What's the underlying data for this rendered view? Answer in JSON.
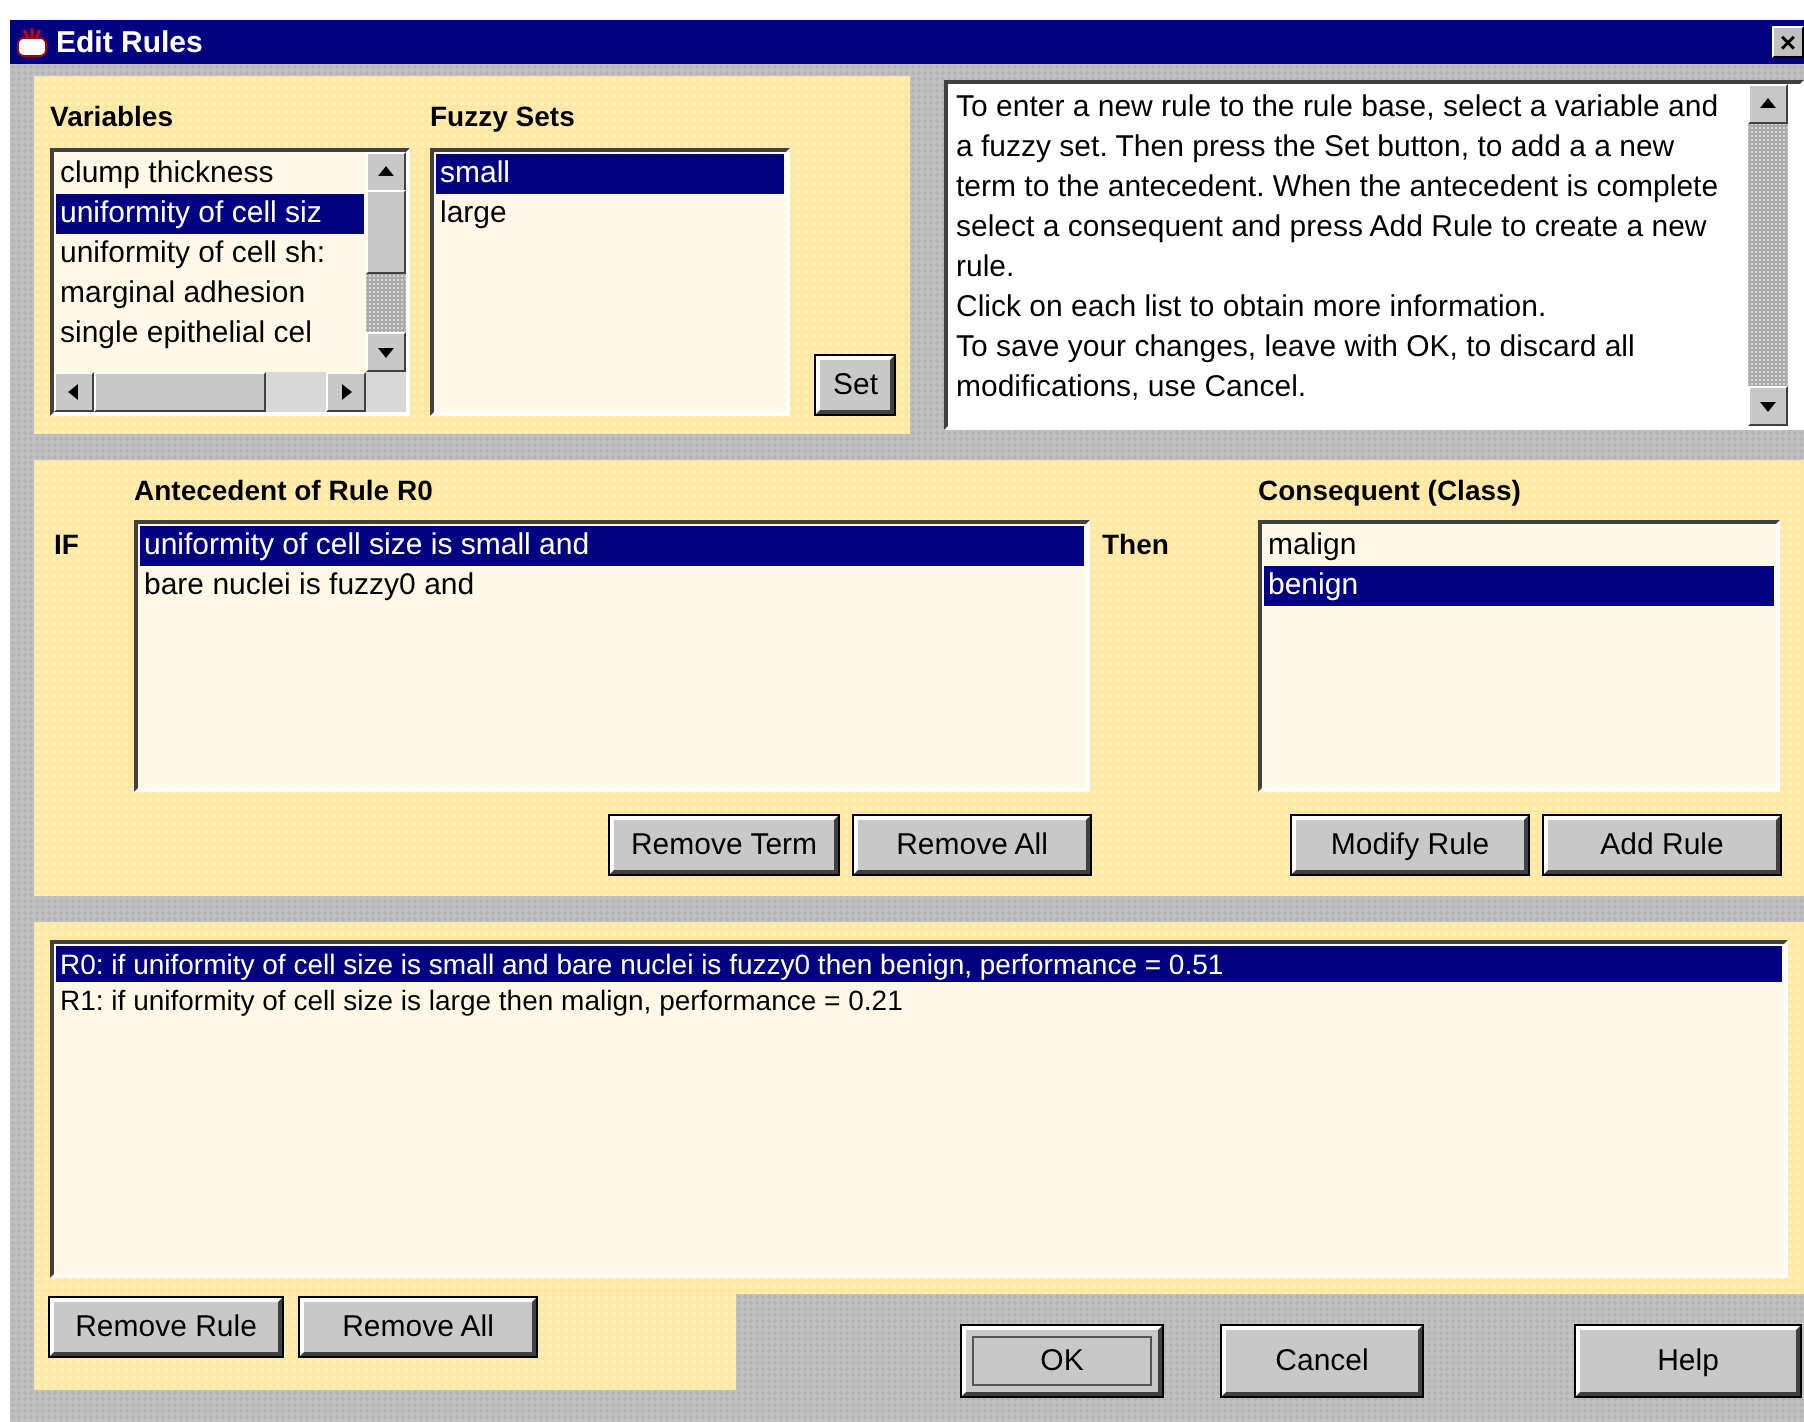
{
  "window": {
    "title": "Edit Rules",
    "close": "×"
  },
  "variables": {
    "label": "Variables",
    "items": [
      {
        "text": "clump thickness",
        "selected": false
      },
      {
        "text": "uniformity of cell siz",
        "selected": true
      },
      {
        "text": "uniformity of cell sh:",
        "selected": false
      },
      {
        "text": "marginal adhesion",
        "selected": false
      },
      {
        "text": "single epithelial cel",
        "selected": false
      }
    ]
  },
  "fuzzy_sets": {
    "label": "Fuzzy Sets",
    "items": [
      {
        "text": "small",
        "selected": true
      },
      {
        "text": "large",
        "selected": false
      }
    ]
  },
  "set_button": "Set",
  "info_text": [
    "To enter a new rule to the rule base, select a variable and a fuzzy set. Then press the Set button, to add a a new term to the antecedent. When the antecedent is complete select a consequent and press Add Rule to create a new rule.",
    "Click on each list to obtain more information.",
    "To save your changes, leave with OK, to discard all modifications, use Cancel."
  ],
  "antecedent": {
    "label": "Antecedent of Rule R0",
    "if_label": "IF",
    "items": [
      {
        "text": "uniformity of cell size is small and",
        "selected": true
      },
      {
        "text": "bare nuclei is fuzzy0 and",
        "selected": false
      }
    ],
    "buttons": [
      "Remove Term",
      "Remove All"
    ]
  },
  "consequent": {
    "then_label": "Then",
    "label": "Consequent (Class)",
    "items": [
      {
        "text": "malign",
        "selected": false
      },
      {
        "text": "benign",
        "selected": true
      }
    ],
    "buttons": [
      "Modify Rule",
      "Add Rule"
    ]
  },
  "rules": {
    "items": [
      {
        "text": "R0: if uniformity of cell size is small and bare nuclei is fuzzy0 then benign, performance = 0.51",
        "selected": true
      },
      {
        "text": "R1: if uniformity of cell size is large then malign, performance = 0.21",
        "selected": false
      }
    ],
    "buttons": [
      "Remove Rule",
      "Remove All"
    ]
  },
  "dialog_buttons": [
    {
      "label": "OK",
      "focused": true
    },
    {
      "label": "Cancel",
      "focused": false
    },
    {
      "label": "Help",
      "focused": false
    }
  ]
}
